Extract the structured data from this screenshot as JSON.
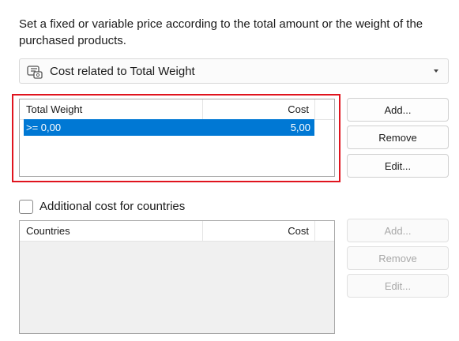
{
  "description": "Set a fixed or variable price according to the total amount or the weight of the purchased products.",
  "mode_select": {
    "value": "Cost related to Total Weight",
    "icon": "price-tag-weight-icon"
  },
  "weight_table": {
    "columns": [
      "Total Weight",
      "Cost"
    ],
    "rows": [
      {
        "weight": ">= 0,00",
        "cost": "5,00"
      }
    ],
    "selected_row": 0
  },
  "weight_buttons": {
    "add": "Add...",
    "remove": "Remove",
    "edit": "Edit..."
  },
  "countries": {
    "checkbox_label": "Additional cost for countries",
    "checked": false,
    "columns": [
      "Countries",
      "Cost"
    ],
    "rows": []
  },
  "country_buttons": {
    "add": "Add...",
    "remove": "Remove",
    "edit": "Edit..."
  },
  "colors": {
    "selection": "#0078d4",
    "highlight_frame": "#e0141e",
    "disabled_text": "#a8a8a8"
  }
}
